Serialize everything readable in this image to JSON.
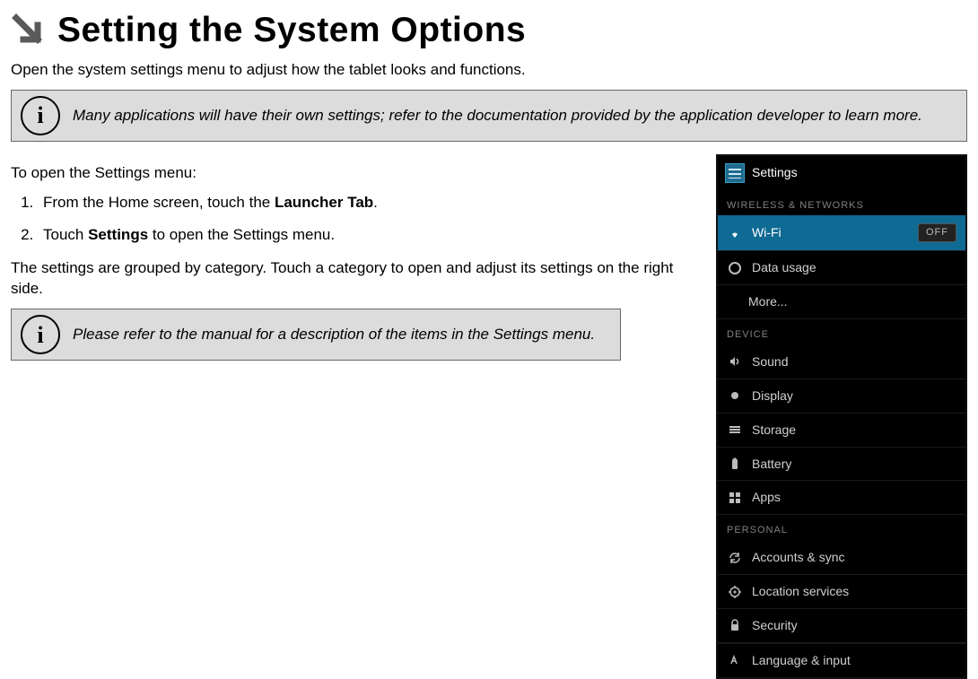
{
  "heading": "Setting the System Options",
  "intro": "Open the system settings menu to adjust how the tablet looks and functions.",
  "infoBox1": "Many applications will have their own settings; refer to the documentation provided by the application developer to learn more.",
  "openMenuLead": "To open the Settings menu:",
  "steps": {
    "s1_prefix": "From the Home screen, touch the ",
    "s1_bold": "Launcher Tab",
    "s1_suffix": ".",
    "s2_prefix": "Touch ",
    "s2_bold": "Settings",
    "s2_suffix": " to open the Settings menu."
  },
  "groupedPara": "The settings are grouped by category. Touch a category to open and adjust its settings on the right side.",
  "infoBox2": "Please refer to the manual for a description of the items in the Settings menu.",
  "infoIconGlyph": "i",
  "phone": {
    "headerTitle": "Settings",
    "cat1": "WIRELESS & NETWORKS",
    "wifi": "Wi-Fi",
    "wifiToggle": "OFF",
    "dataUsage": "Data usage",
    "more": "More...",
    "cat2": "DEVICE",
    "sound": "Sound",
    "display": "Display",
    "storage": "Storage",
    "battery": "Battery",
    "apps": "Apps",
    "cat3": "PERSONAL",
    "accounts": "Accounts & sync",
    "location": "Location services",
    "security": "Security",
    "langPartial": "Language & input"
  }
}
